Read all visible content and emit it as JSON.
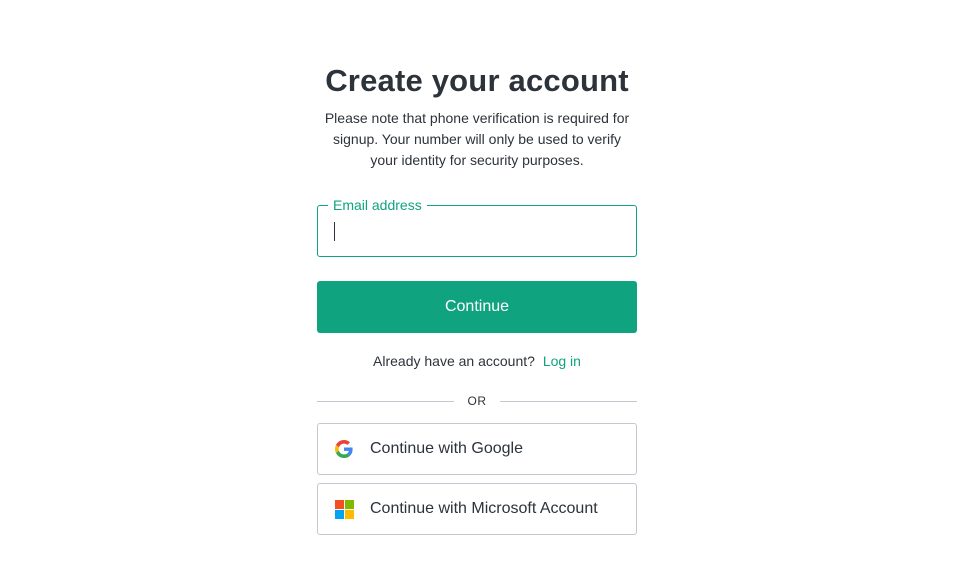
{
  "signup": {
    "title": "Create your account",
    "subtitle": "Please note that phone verification is required for signup. Your number will only be used to verify your identity for security purposes.",
    "email_label": "Email address",
    "email_value": "",
    "continue_label": "Continue",
    "login_prompt": "Already have an account?",
    "login_link": "Log in",
    "divider_text": "OR",
    "google_label": "Continue with Google",
    "microsoft_label": "Continue with Microsoft Account"
  },
  "colors": {
    "accent": "#10a37f",
    "text": "#2d333a",
    "border": "#c2c8d0"
  },
  "icons": {
    "google": "google-logo-icon",
    "microsoft": "microsoft-logo-icon"
  }
}
